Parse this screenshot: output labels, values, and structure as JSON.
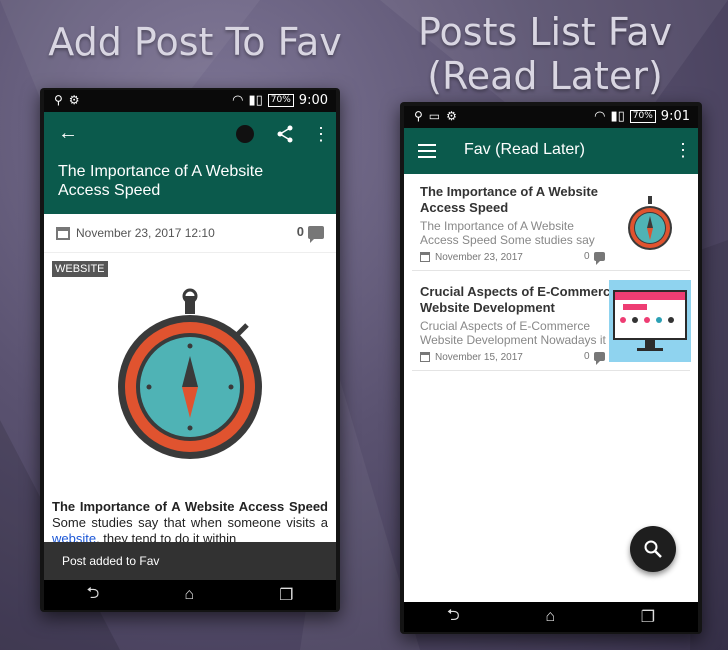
{
  "headings": {
    "left": "Add Post To Fav",
    "right_line1": "Posts List Fav",
    "right_line2": "(Read Later)"
  },
  "left_phone": {
    "status": {
      "time": "9:00",
      "battery": "70%"
    },
    "appbar": {
      "title": "The Importance of A Website Access Speed",
      "icons": [
        "back-arrow-icon",
        "clock-icon",
        "share-icon",
        "more-vert-icon"
      ]
    },
    "meta": {
      "date": "November 23, 2017 12:10",
      "comments": "0"
    },
    "category": "WEBSITE",
    "body": {
      "bold": "The Importance of A Website Access Speed",
      "text1": " Some studies say that when someone visits a ",
      "link": "website",
      "text2": ", they tend to do it within"
    },
    "snackbar": "Post added to Fav"
  },
  "right_phone": {
    "status": {
      "time": "9:01",
      "battery": "70%"
    },
    "appbar": {
      "title": "Fav (Read Later)",
      "icons": [
        "menu-icon",
        "more-vert-icon"
      ]
    },
    "cards": [
      {
        "title": "The Importance of A Website Access Speed",
        "excerpt": "The Importance of A Website Access Speed Some studies say",
        "date": "November 23, 2017",
        "comments": "0",
        "thumb": "stopwatch"
      },
      {
        "title": "Crucial Aspects of E-Commerce Website Development",
        "excerpt": "Crucial Aspects of E-Commerce Website Development Nowadays it",
        "date": "November 15, 2017",
        "comments": "0",
        "thumb": "ecommerce-monitor"
      }
    ],
    "fab": "search-icon"
  },
  "colors": {
    "appbar": "#0b5a4c",
    "accent_orange": "#e0532f",
    "teal_face": "#4fb3b5",
    "link": "#1a56d6",
    "snackbar": "#323232"
  }
}
